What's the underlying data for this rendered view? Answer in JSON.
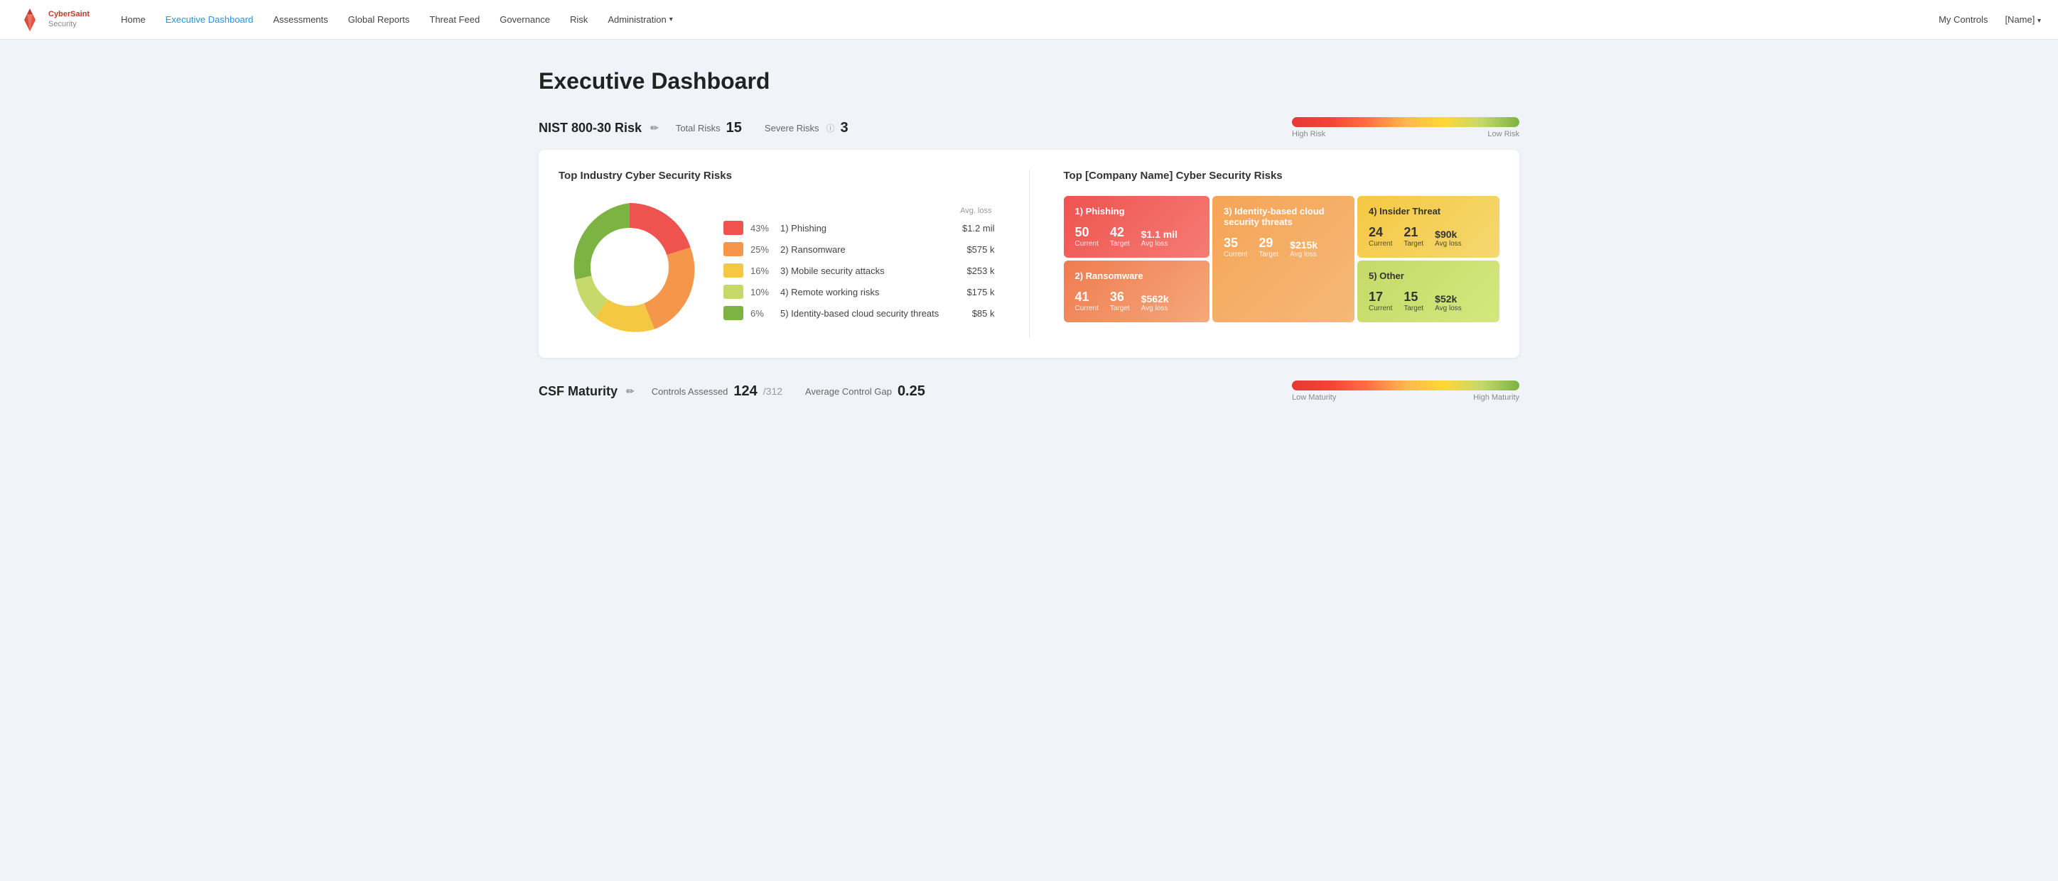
{
  "nav": {
    "logo_name": "CyberSaint",
    "logo_sub": "Security",
    "links": [
      {
        "id": "home",
        "label": "Home"
      },
      {
        "id": "executive-dashboard",
        "label": "Executive Dashboard"
      },
      {
        "id": "assessments",
        "label": "Assessments"
      },
      {
        "id": "global-reports",
        "label": "Global Reports"
      },
      {
        "id": "threat-feed",
        "label": "Threat Feed"
      },
      {
        "id": "governance",
        "label": "Governance"
      },
      {
        "id": "risk",
        "label": "Risk"
      },
      {
        "id": "administration",
        "label": "Administration",
        "has_dropdown": true
      }
    ],
    "my_controls": "My Controls",
    "user_name": "[Name]"
  },
  "page": {
    "title": "Executive Dashboard"
  },
  "nist_section": {
    "title": "NIST 800-30 Risk",
    "total_risks_label": "Total Risks",
    "total_risks_value": "15",
    "severe_risks_label": "Severe Risks",
    "severe_risks_value": "3",
    "high_risk_label": "High Risk",
    "low_risk_label": "Low Risk"
  },
  "industry_panel": {
    "title": "Top Industry Cyber Security Risks",
    "avg_loss_header": "Avg. loss",
    "items": [
      {
        "color": "#ef5350",
        "pct": "43%",
        "rank": "1)",
        "name": "Phishing",
        "avg_loss": "$1.2 mil"
      },
      {
        "color": "#f5974a",
        "pct": "25%",
        "rank": "2)",
        "name": "Ransomware",
        "avg_loss": "$575 k"
      },
      {
        "color": "#f5c842",
        "pct": "16%",
        "rank": "3)",
        "name": "Mobile security attacks",
        "avg_loss": "$253 k"
      },
      {
        "color": "#c6d96a",
        "pct": "10%",
        "rank": "4)",
        "name": "Remote working risks",
        "avg_loss": "$175 k"
      },
      {
        "color": "#7cb342",
        "pct": "6%",
        "rank": "5)",
        "name": "Identity-based cloud security threats",
        "avg_loss": "$85 k"
      }
    ],
    "donut": {
      "segments": [
        {
          "color": "#ef5350",
          "pct": 43
        },
        {
          "color": "#f5974a",
          "pct": 25
        },
        {
          "color": "#f5c842",
          "pct": 16
        },
        {
          "color": "#c6d96a",
          "pct": 10
        },
        {
          "color": "#7cb342",
          "pct": 6
        }
      ]
    }
  },
  "company_panel": {
    "title": "Top [Company Name] Cyber Security Risks",
    "tiles": [
      {
        "id": "phishing",
        "name": "1) Phishing",
        "current_value": "50",
        "current_label": "Current",
        "target_value": "42",
        "target_label": "Target",
        "avg_loss_value": "$1.1 mil",
        "avg_loss_label": "Avg loss"
      },
      {
        "id": "ransomware",
        "name": "2) Ransomware",
        "current_value": "41",
        "current_label": "Current",
        "target_value": "36",
        "target_label": "Target",
        "avg_loss_value": "$562k",
        "avg_loss_label": "Avg loss"
      },
      {
        "id": "identity",
        "name": "3) Identity-based cloud security threats",
        "current_value": "35",
        "current_label": "Current",
        "target_value": "29",
        "target_label": "Target",
        "avg_loss_value": "$215k",
        "avg_loss_label": "Avg loss"
      },
      {
        "id": "insider",
        "name": "4) Insider Threat",
        "current_value": "24",
        "current_label": "Current",
        "target_value": "21",
        "target_label": "Target",
        "avg_loss_value": "$90k",
        "avg_loss_label": "Avg loss"
      },
      {
        "id": "other",
        "name": "5) Other",
        "current_value": "17",
        "current_label": "Current",
        "target_value": "15",
        "target_label": "Target",
        "avg_loss_value": "$52k",
        "avg_loss_label": "Avg loss"
      }
    ]
  },
  "csf_section": {
    "title": "CSF Maturity",
    "controls_assessed_label": "Controls Assessed",
    "controls_assessed_value": "124",
    "controls_total": "/312",
    "avg_control_gap_label": "Average Control Gap",
    "avg_control_gap_value": "0.25",
    "low_maturity_label": "Low Maturity",
    "high_maturity_label": "High Maturity"
  }
}
